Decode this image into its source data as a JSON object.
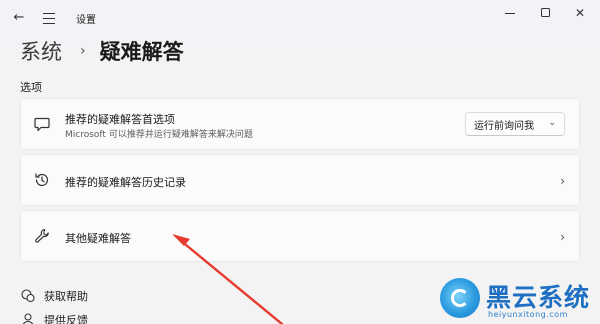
{
  "window": {
    "title": "设置",
    "back_icon": "back-arrow-icon",
    "menu_icon": "hamburger-icon",
    "controls": [
      "minimize",
      "maximize",
      "close"
    ]
  },
  "breadcrumb": {
    "parent": "系统",
    "separator": "›",
    "current": "疑难解答"
  },
  "section_label": "选项",
  "cards": [
    {
      "icon": "chat-icon",
      "title": "推荐的疑难解答首选项",
      "subtitle": "Microsoft 可以推荐并运行疑难解答来解决问题",
      "dropdown_value": "运行前询问我"
    },
    {
      "icon": "history-icon",
      "title": "推荐的疑难解答历史记录"
    },
    {
      "icon": "wrench-icon",
      "title": "其他疑难解答"
    }
  ],
  "help_links": [
    {
      "icon": "help-icon",
      "label": "获取帮助"
    },
    {
      "icon": "feedback-icon",
      "label": "提供反馈"
    }
  ],
  "annotation": {
    "color": "#e63b2e"
  },
  "watermark": {
    "title": "黑云系统",
    "url": "heiyunxitong.com",
    "color": "#1f6fc2"
  }
}
